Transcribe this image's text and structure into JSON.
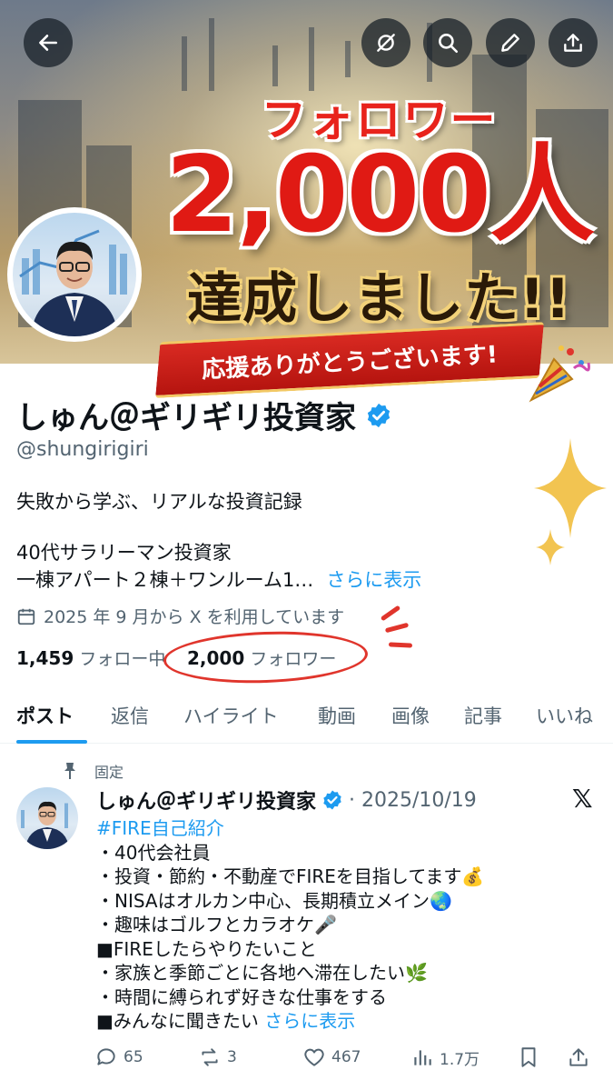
{
  "banner": {
    "headline_small": "フォロワー",
    "headline_count": "2,000人",
    "headline_done": "達成しました!!",
    "ribbon_text": "応援ありがとうございます!"
  },
  "toolbar": {
    "buttons": [
      "back-icon",
      "share-dm-icon",
      "search-icon",
      "edit-icon",
      "upload-icon"
    ]
  },
  "profile": {
    "name": "しゅん＠ギリギリ投資家",
    "handle": "@shungirigiri",
    "bio_line1": "失敗から学ぶ、リアルな投資記録",
    "bio_line2": "40代サラリーマン投資家",
    "bio_line3": "一棟アパート２棟＋ワンルーム1…",
    "show_more": "さらに表示",
    "joined": "2025 年 9 月から X を利用しています",
    "following_count": "1,459",
    "following_label": "フォロー中",
    "followers_count": "2,000",
    "followers_label": "フォロワー",
    "verified_color": "#1d9bf0"
  },
  "tabs": [
    {
      "label": "ポスト",
      "active": true
    },
    {
      "label": "返信"
    },
    {
      "label": "ハイライト"
    },
    {
      "label": "動画"
    },
    {
      "label": "画像"
    },
    {
      "label": "記事"
    },
    {
      "label": "いいね"
    }
  ],
  "post": {
    "pinned_label": "固定",
    "author": "しゅん＠ギリギリ投資家",
    "date": "· 2025/10/19",
    "hashtag": "#FIRE自己紹介",
    "lines": [
      "・40代会社員",
      "・投資・節約・不動産でFIREを目指してます💰",
      "・NISAはオルカン中心、長期積立メイン🌏",
      "・趣味はゴルフとカラオケ🎤",
      "■FIREしたらやりたいこと",
      "・家族と季節ごとに各地へ滞在したい🌿",
      "・時間に縛られず好きな仕事をする"
    ],
    "last_line": "■みんなに聞きたい",
    "show_more": "さらに表示",
    "replies": "65",
    "reposts": "3",
    "likes": "467",
    "views": "1.7万"
  },
  "colors": {
    "accent": "#1d9bf0",
    "highlight": "#e0352c",
    "text_secondary": "#536471"
  }
}
